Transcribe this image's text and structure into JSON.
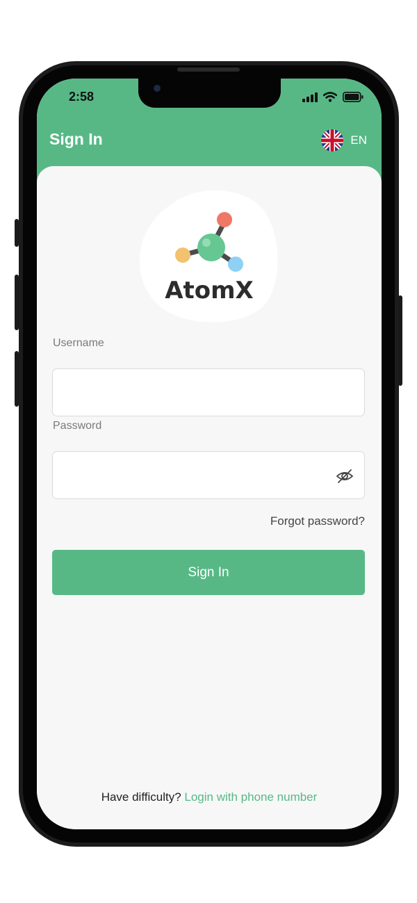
{
  "status_bar": {
    "time": "2:58"
  },
  "header": {
    "title": "Sign In",
    "language": "EN"
  },
  "logo": {
    "text": "AtomX"
  },
  "form": {
    "username_label": "Username",
    "username_value": "",
    "password_label": "Password",
    "password_value": "",
    "forgot_label": "Forgot password?",
    "submit_label": "Sign In"
  },
  "footer": {
    "prompt": "Have difficulty?",
    "link_label": "Login with phone number"
  },
  "colors": {
    "brand": "#57b886",
    "background": "#f7f7f7",
    "frame": "#1c1c1e"
  },
  "icons": [
    "uk-flag-icon",
    "eye-off-icon",
    "signal-icon",
    "wifi-icon",
    "battery-icon",
    "atom-logo-icon"
  ]
}
